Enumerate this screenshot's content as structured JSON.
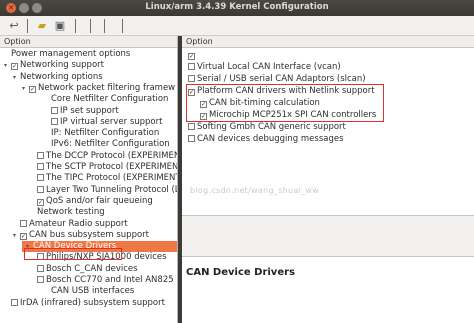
{
  "window": {
    "title": "Linux/arm 3.4.39 Kernel Configuration"
  },
  "left": {
    "header": "Option",
    "rows": [
      {
        "text": "Power management options",
        "check": "",
        "expander": ""
      },
      {
        "text": "Networking support",
        "check": "☑",
        "expander": "▾"
      },
      {
        "text": "Networking options",
        "check": "",
        "expander": "▾"
      },
      {
        "text": "Network packet filtering framew",
        "check": "☑",
        "expander": "▾"
      },
      {
        "text": "Core Netfilter Configuration",
        "check": "",
        "expander": ""
      },
      {
        "text": "IP set support",
        "check": "☐",
        "expander": ""
      },
      {
        "text": "IP virtual server support",
        "check": "☐",
        "expander": ""
      },
      {
        "text": "IP: Netfilter Configuration",
        "check": "",
        "expander": ""
      },
      {
        "text": "IPv6: Netfilter Configuration",
        "check": "",
        "expander": ""
      },
      {
        "text": "The DCCP Protocol (EXPERIMENT",
        "check": "☐",
        "expander": ""
      },
      {
        "text": "The SCTP Protocol (EXPERIMENT",
        "check": "☐",
        "expander": ""
      },
      {
        "text": "The TIPC Protocol (EXPERIMENT",
        "check": "☐",
        "expander": ""
      },
      {
        "text": "Layer Two Tunneling Protocol (L2",
        "check": "☐",
        "expander": ""
      },
      {
        "text": "QoS and/or fair queueing",
        "check": "☑",
        "expander": ""
      },
      {
        "text": "Network testing",
        "check": "",
        "expander": ""
      },
      {
        "text": "Amateur Radio support",
        "check": "☐",
        "expander": ""
      },
      {
        "text": "CAN bus subsystem support",
        "check": "☑",
        "expander": "▾"
      },
      {
        "text": "CAN Device Drivers",
        "check": "",
        "expander": "▾"
      },
      {
        "text": "Philips/NXP SJA1000 devices",
        "check": "☐",
        "expander": ""
      },
      {
        "text": "Bosch C_CAN devices",
        "check": "☐",
        "expander": ""
      },
      {
        "text": "Bosch CC770 and Intel AN825",
        "check": "☐",
        "expander": ""
      },
      {
        "text": "CAN USB interfaces",
        "check": "",
        "expander": ""
      },
      {
        "text": "IrDA (infrared) subsystem support",
        "check": "☐",
        "expander": ""
      }
    ]
  },
  "right": {
    "header": "Option",
    "rows": [
      {
        "text": "",
        "check": "☑"
      },
      {
        "text": "Virtual Local CAN Interface (vcan)",
        "check": "☐"
      },
      {
        "text": "Serial / USB serial CAN Adaptors (slcan)",
        "check": "☐"
      },
      {
        "text": "Platform CAN drivers with Netlink support",
        "check": "☑"
      },
      {
        "text": "CAN bit-timing calculation",
        "check": "☑"
      },
      {
        "text": "Microchip MCP251x SPI CAN controllers",
        "check": "☑"
      },
      {
        "text": "Softing Gmbh CAN generic support",
        "check": "☐"
      },
      {
        "text": "CAN devices debugging messages",
        "check": "☐"
      }
    ],
    "help_title": "CAN Device Drivers"
  },
  "watermark": "blog.csdn.net/wang_shuai_ww",
  "colors": {
    "selection": "#f07746",
    "annotation": "#d9312b"
  }
}
